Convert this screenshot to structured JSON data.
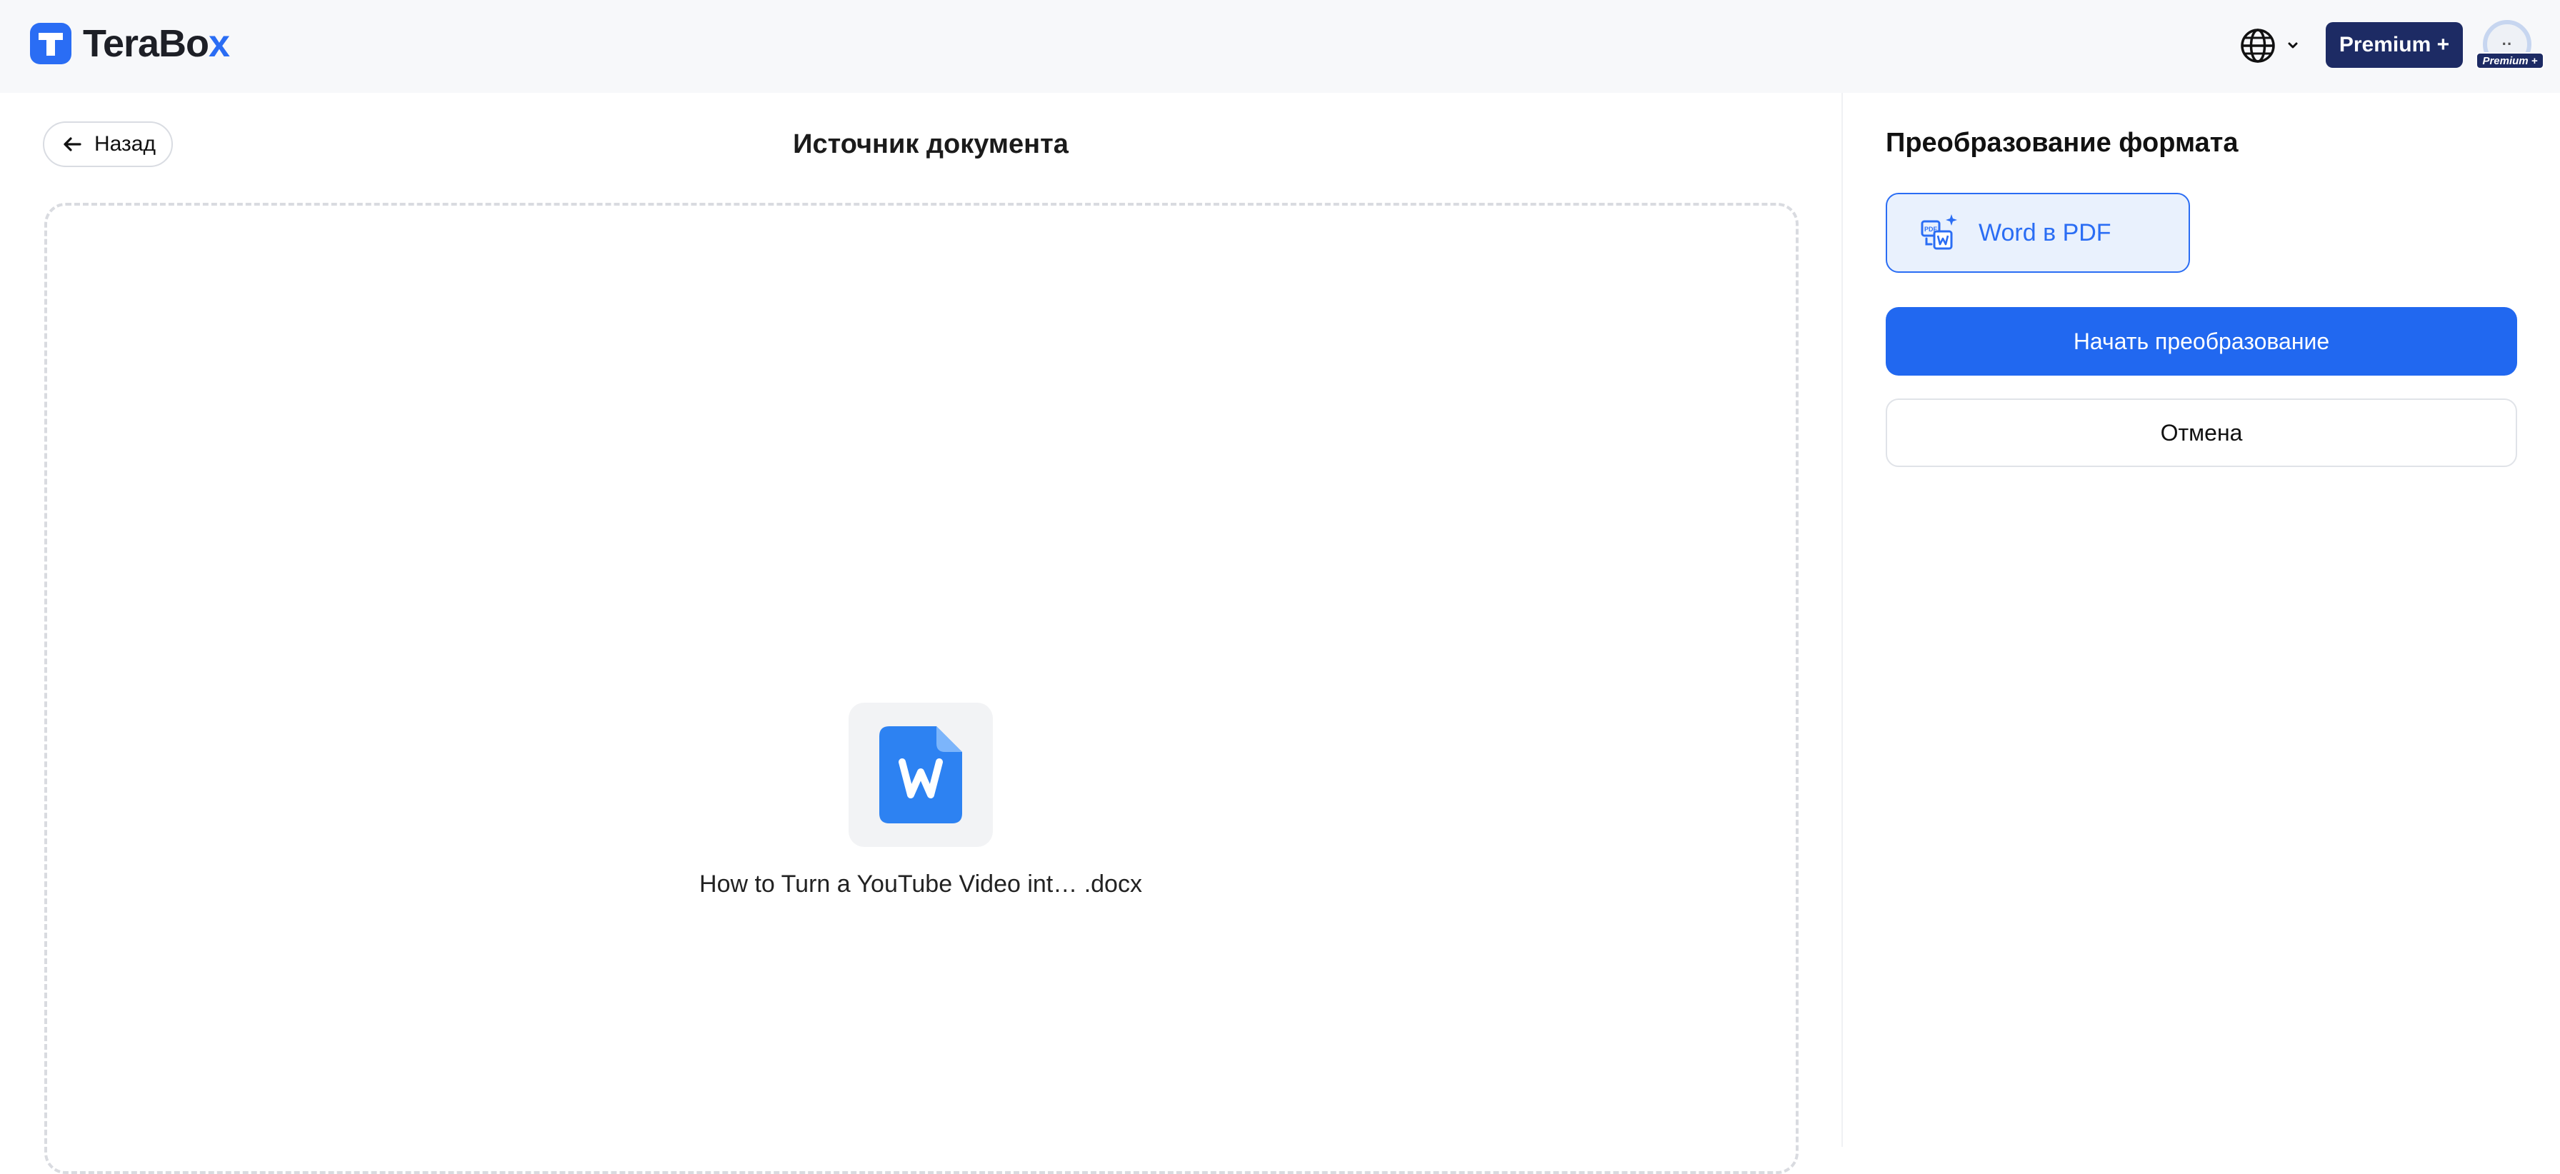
{
  "header": {
    "logo_text_main": "TeraBo",
    "logo_text_accent": "x",
    "language_icon": "globe-icon",
    "premium_label": "Premium +",
    "avatar_initials": "··",
    "avatar_badge": "Premium +"
  },
  "left_panel": {
    "back_label": "Назад",
    "title": "Источник документа",
    "file": {
      "icon": "word-file-icon",
      "name": "How to Turn a YouTube Video int… .docx"
    }
  },
  "right_panel": {
    "title": "Преобразование формата",
    "format_option": {
      "icon": "pdf-word-convert-icon",
      "label": "Word в PDF"
    },
    "start_label": "Начать преобразование",
    "cancel_label": "Отмена"
  },
  "colors": {
    "accent": "#2168f0",
    "premium": "#1d2b64",
    "topbar_bg": "#f7f8fa",
    "option_bg": "#e9f1fd"
  }
}
